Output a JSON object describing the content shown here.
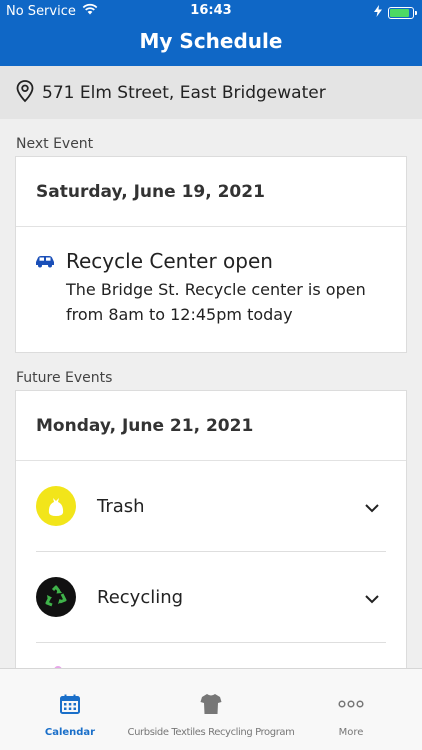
{
  "status": {
    "carrier": "No Service",
    "time": "16:43",
    "battery_level": 0.85,
    "battery_color": "#4cd964"
  },
  "header": {
    "title": "My Schedule",
    "background": "#0f67c6"
  },
  "address": {
    "icon": "location-pin-icon",
    "text": "571 Elm Street, East Bridgewater"
  },
  "next_event": {
    "section_label": "Next Event",
    "date": "Saturday, June 19, 2021",
    "event": {
      "icon": "car-icon",
      "title": "Recycle Center open",
      "description": "The Bridge St. Recycle center is open from 8am to 12:45pm today"
    }
  },
  "future_events": {
    "section_label": "Future Events",
    "date": "Monday, June 21, 2021",
    "items": [
      {
        "label": "Trash",
        "icon": "trash-bag-icon",
        "icon_bg": "#f2e51a"
      },
      {
        "label": "Recycling",
        "icon": "recycle-icon",
        "icon_bg": "#111111"
      }
    ]
  },
  "tab_bar": {
    "tabs": [
      {
        "label": "Calendar",
        "icon": "calendar-icon",
        "active": true,
        "color": "#1a6fc9"
      },
      {
        "label": "Curbside Textiles Recycling Program",
        "icon": "shirt-icon",
        "active": false,
        "color": "#777777"
      },
      {
        "label": "More",
        "icon": "more-icon",
        "active": false,
        "color": "#777777"
      }
    ]
  }
}
